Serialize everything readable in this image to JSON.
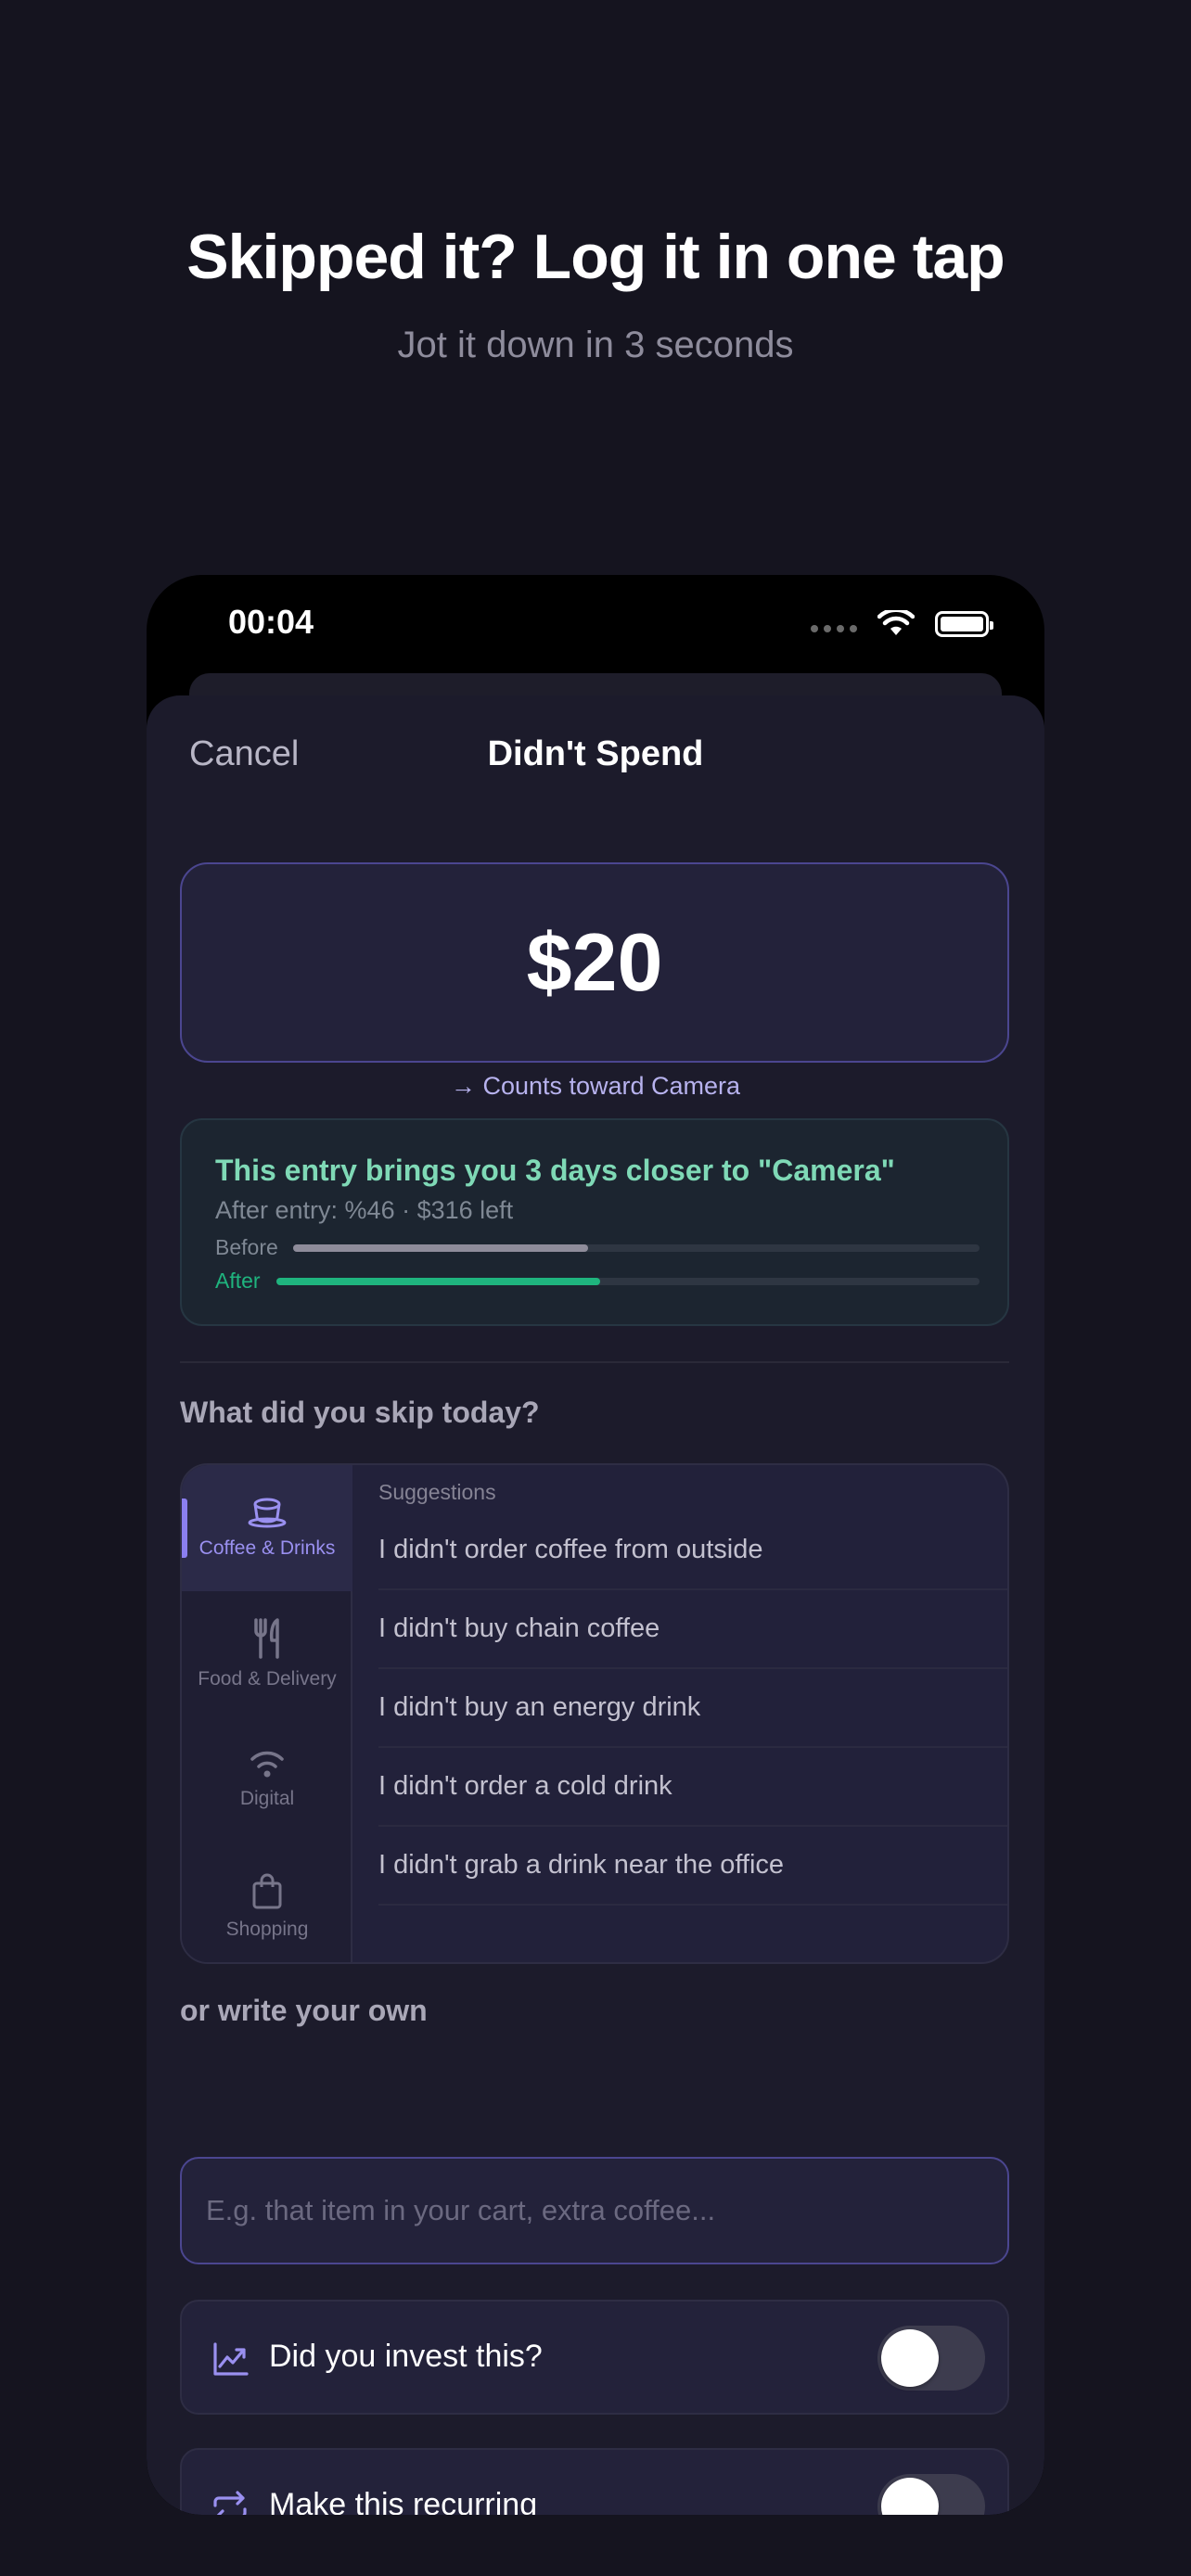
{
  "headline": "Skipped it? Log it in one tap",
  "subheadline": "Jot it down in 3 seconds",
  "status_bar": {
    "time": "00:04"
  },
  "sheet": {
    "cancel_label": "Cancel",
    "title": "Didn't Spend",
    "amount": "$20",
    "counts_toward": "→ Counts toward Camera"
  },
  "progress_card": {
    "title": "This entry brings you 3 days closer to \"Camera\"",
    "subtitle": "After entry: %46 · $316 left",
    "before_label": "Before",
    "after_label": "After",
    "before_fraction": 0.43,
    "after_fraction": 0.46,
    "before_color": "#8e8c9a",
    "after_color": "#1fb47e"
  },
  "skip_section_label": "What did you skip today?",
  "categories": [
    {
      "label": "Coffee & Drinks",
      "icon": "coffee-cup-icon",
      "active": true
    },
    {
      "label": "Food & Delivery",
      "icon": "fork-knife-icon",
      "active": false
    },
    {
      "label": "Digital",
      "icon": "wifi-icon",
      "active": false
    },
    {
      "label": "Shopping",
      "icon": "shopping-bag-icon",
      "active": false
    }
  ],
  "suggestions_header": "Suggestions",
  "suggestions": [
    "I didn't order coffee from outside",
    "I didn't buy chain coffee",
    "I didn't buy an energy drink",
    "I didn't order a cold drink",
    "I didn't grab a drink near the office"
  ],
  "own_section_label": "or write your own",
  "own_input_placeholder": "E.g. that item in your cart, extra coffee...",
  "toggles": [
    {
      "label": "Did you invest this?",
      "icon": "chart-line-icon",
      "on": false
    },
    {
      "label": "Make this recurring",
      "icon": "repeat-icon",
      "on": false
    }
  ],
  "accent_color": "#8b7ff0"
}
